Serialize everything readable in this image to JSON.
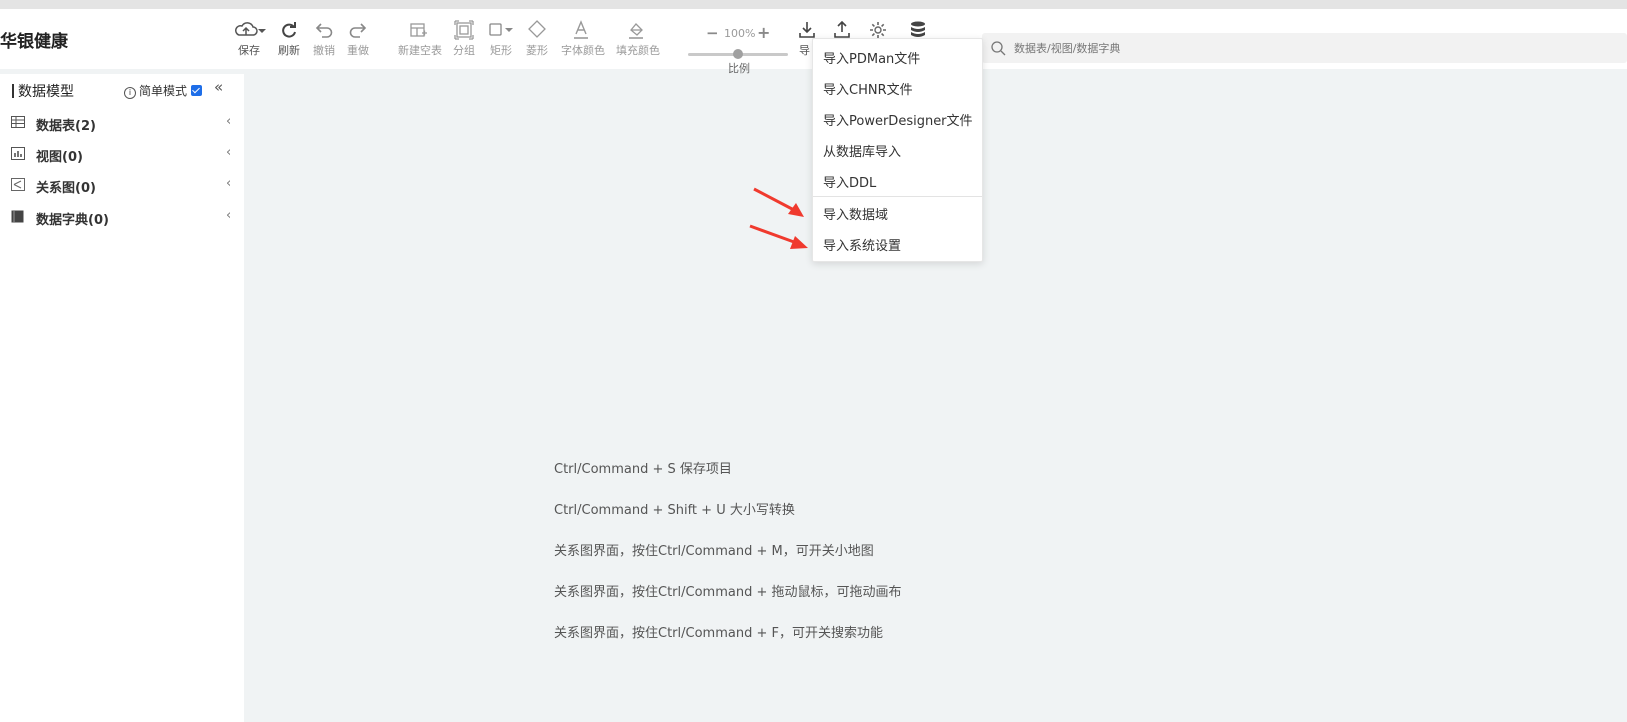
{
  "app": {
    "title": "华银健康"
  },
  "toolbar": {
    "save": "保存",
    "refresh": "刷新",
    "undo": "撤销",
    "redo": "重做",
    "new_table": "新建空表",
    "group": "分组",
    "rect": "矩形",
    "diamond": "菱形",
    "font_color": "字体颜色",
    "fill_color": "填充颜色",
    "import_truncated": "导",
    "zoom": {
      "minus": "−",
      "value": "100%",
      "plus": "+",
      "label": "比例",
      "level_percent": 100
    }
  },
  "search": {
    "placeholder": "数据表/视图/数据字典"
  },
  "sidebar": {
    "title": "数据模型",
    "simple_mode": "简单模式",
    "simple_mode_checked": true,
    "collapse": "«",
    "items": [
      {
        "label": "数据表(2)",
        "icon": "table-icon"
      },
      {
        "label": "视图(0)",
        "icon": "view-chart-icon"
      },
      {
        "label": "关系图(0)",
        "icon": "relation-diagram-icon"
      },
      {
        "label": "数据字典(0)",
        "icon": "dictionary-book-icon"
      }
    ],
    "chevron": "‹"
  },
  "import_menu": {
    "items": [
      "导入PDMan文件",
      "导入CHNR文件",
      "导入PowerDesigner文件",
      "从数据库导入",
      "导入DDL",
      "导入数据域",
      "导入系统设置"
    ]
  },
  "tips": [
    "Ctrl/Command + S 保存项目",
    "Ctrl/Command + Shift + U 大小写转换",
    "关系图界面，按住Ctrl/Command + M，可开关小地图",
    "关系图界面，按住Ctrl/Command + 拖动鼠标，可拖动画布",
    "关系图界面，按住Ctrl/Command + F，可开关搜索功能"
  ],
  "colors": {
    "accent": "#1e6ee8",
    "annotation_arrow": "#f03a2e"
  }
}
